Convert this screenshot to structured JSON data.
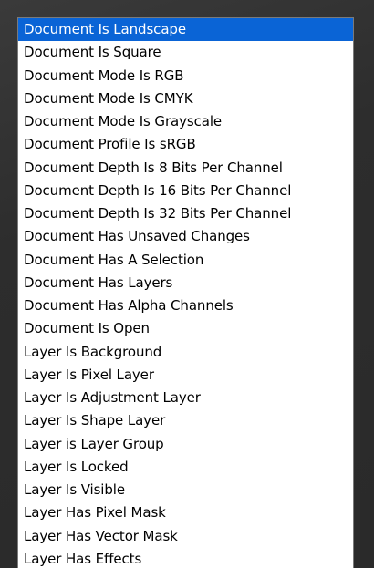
{
  "options": [
    "Document Is Landscape",
    "Document Is Square",
    "Document Mode Is RGB",
    "Document Mode Is CMYK",
    "Document Mode Is Grayscale",
    "Document Profile Is sRGB",
    "Document Depth Is 8 Bits Per Channel",
    "Document Depth Is 16 Bits Per Channel",
    "Document Depth Is 32 Bits Per Channel",
    "Document Has Unsaved Changes",
    "Document Has A Selection",
    "Document Has Layers",
    "Document Has Alpha Channels",
    "Document Is Open",
    "Layer Is Background",
    "Layer Is Pixel Layer",
    "Layer Is Adjustment Layer",
    "Layer Is Shape Layer",
    "Layer is Layer Group",
    "Layer Is Locked",
    "Layer Is Visible",
    "Layer Has Pixel Mask",
    "Layer Has Vector Mask",
    "Layer Has Effects"
  ],
  "selected_index": 0,
  "colors": {
    "selection_bg": "#0a64d6",
    "selection_fg": "#ffffff",
    "list_bg": "#ffffff",
    "backdrop": "#2f2f2f"
  }
}
